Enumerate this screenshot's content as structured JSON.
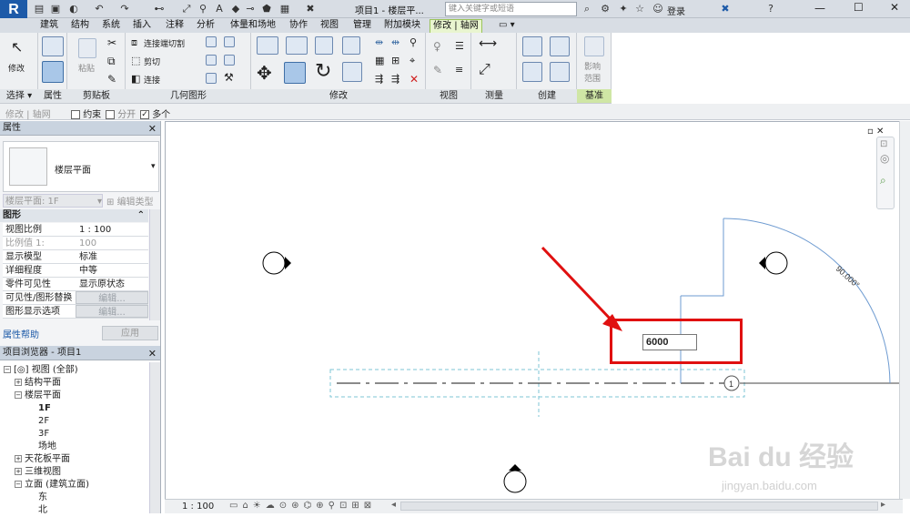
{
  "app": {
    "title": "项目1 - 楼层平...",
    "search_placeholder": "键入关键字或短语",
    "login": "登录"
  },
  "menu_tabs": [
    "建筑",
    "结构",
    "系统",
    "插入",
    "注释",
    "分析",
    "体量和场地",
    "协作",
    "视图",
    "管理",
    "附加模块",
    "修改 | 轴网"
  ],
  "ribbon": {
    "modify_label": "修改",
    "paste_label": "粘贴",
    "join_cut_label": "连接端切割",
    "cut_label": "剪切",
    "join_label": "连接",
    "influence_label": "影响\n范围",
    "panels": [
      "选择",
      "属性",
      "剪贴板",
      "几何图形",
      "修改",
      "视图",
      "测量",
      "创建",
      "基准"
    ]
  },
  "options_bar": {
    "context": "修改 | 轴网",
    "constraint": "约束",
    "split": "分开",
    "multiple": "多个",
    "multiple_checked": true
  },
  "properties": {
    "header": "属性",
    "type_name": "楼层平面",
    "instance_selector": "楼层平面: 1F",
    "edit_type": "编辑类型",
    "group": "图形",
    "rows": [
      {
        "label": "视图比例",
        "value": "1 : 100"
      },
      {
        "label": "比例值 1:",
        "value": "100"
      },
      {
        "label": "显示模型",
        "value": "标准"
      },
      {
        "label": "详细程度",
        "value": "中等"
      },
      {
        "label": "零件可见性",
        "value": "显示原状态"
      },
      {
        "label": "可见性/图形替换",
        "value": "编辑..."
      },
      {
        "label": "图形显示选项",
        "value": "编辑..."
      }
    ],
    "help": "属性帮助",
    "apply": "应用"
  },
  "project_browser": {
    "header": "项目浏览器 - 项目1",
    "nodes": [
      {
        "label": "[◎] 视图 (全部)",
        "level": 0
      },
      {
        "label": "结构平面",
        "level": 1
      },
      {
        "label": "楼层平面",
        "level": 1
      },
      {
        "label": "1F",
        "level": 2
      },
      {
        "label": "2F",
        "level": 2
      },
      {
        "label": "3F",
        "level": 2
      },
      {
        "label": "场地",
        "level": 2
      },
      {
        "label": "天花板平面",
        "level": 1
      },
      {
        "label": "三维视图",
        "level": 1
      },
      {
        "label": "立面 (建筑立面)",
        "level": 1
      },
      {
        "label": "东",
        "level": 2
      },
      {
        "label": "北",
        "level": 2
      }
    ]
  },
  "canvas": {
    "dimension_value": "6000",
    "angle_label": "90.000°",
    "grid_bubble": "1"
  },
  "status": {
    "scale": "1 : 100"
  },
  "watermark": {
    "logo": "Bai du 经验",
    "url": "jingyan.baidu.com"
  },
  "colors": {
    "accent_red": "#e01010",
    "grid_blue": "#6e9bd1",
    "ribbon_green": "#cfe6a5"
  }
}
